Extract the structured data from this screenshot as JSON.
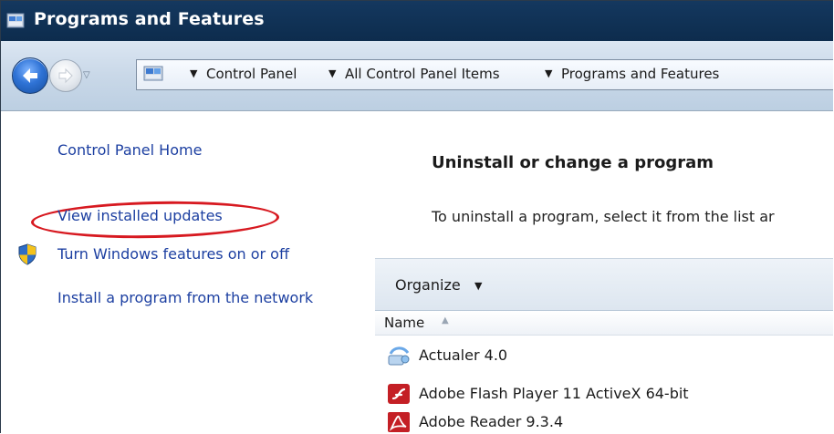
{
  "window": {
    "title": "Programs and Features"
  },
  "navigation": {
    "breadcrumbs": [
      "Control Panel",
      "All Control Panel Items",
      "Programs and Features"
    ]
  },
  "left_pane": {
    "home_link": "Control Panel Home",
    "view_updates_link": "View installed updates",
    "windows_features_link": "Turn Windows features on or off",
    "network_install_link": "Install a program from the network"
  },
  "main": {
    "heading": "Uninstall or change a program",
    "description": "To uninstall a program, select it from the list ar"
  },
  "toolbar": {
    "organize_label": "Organize"
  },
  "list": {
    "columns": [
      "Name"
    ],
    "programs": [
      {
        "name": "Actualer 4.0",
        "icon": "actualer-icon"
      },
      {
        "name": "Adobe Flash Player 11 ActiveX 64-bit",
        "icon": "flash-player-icon"
      },
      {
        "name": "Adobe Reader 9.3.4",
        "icon": "adobe-reader-icon"
      }
    ]
  },
  "colors": {
    "title_bar": "#14385f",
    "link": "#1c3fa1",
    "highlight": "#d71920"
  }
}
